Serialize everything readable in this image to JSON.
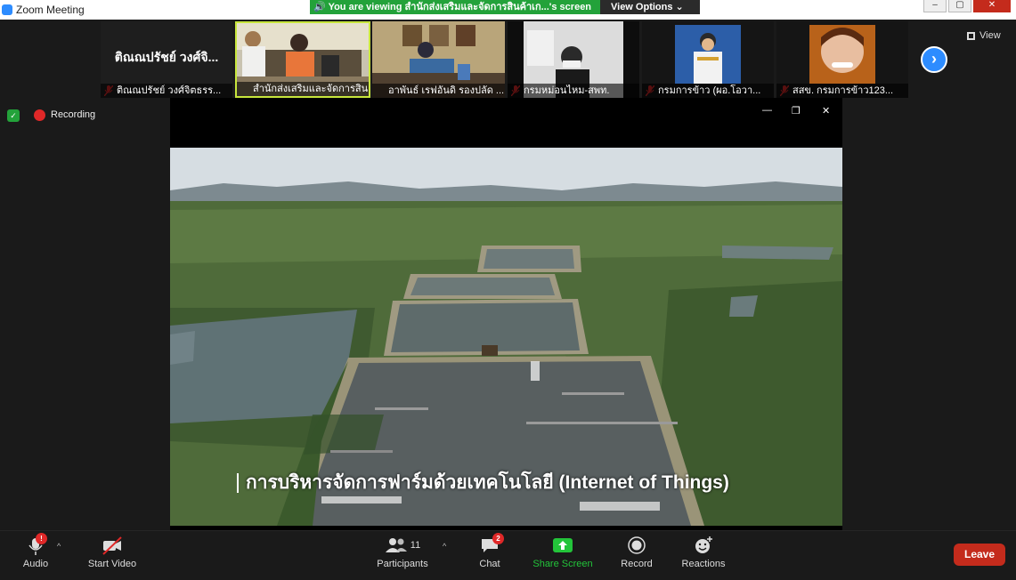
{
  "window": {
    "title": "Zoom Meeting"
  },
  "share_banner": {
    "viewing_text": "You are viewing สำนักส่งเสริมและจัดการสินค้าเก...'s screen",
    "view_options_label": "View Options ⌄"
  },
  "gallery": {
    "view_label": "View",
    "participants": [
      {
        "name": "ติณณปรัชย์ วงศ์จิตธรร...",
        "display": "ติณณปรัชย์ วงศ์จิ...",
        "video": false,
        "muted": true,
        "active": false
      },
      {
        "name": "สำนักส่งเสริมและจัดการสิน...",
        "video": true,
        "muted": false,
        "active": true
      },
      {
        "name": "อาพันธ์ เรฟอันดิ รองปลัด ...",
        "video": true,
        "muted": false,
        "active": false
      },
      {
        "name": "กรมหม่อนไหม-สพท.",
        "video": true,
        "muted": true,
        "active": false
      },
      {
        "name": "กรมการข้าว (ผอ.โอวา...",
        "video": true,
        "muted": true,
        "active": false
      },
      {
        "name": "สสข. กรมการข้าว123...",
        "video": true,
        "muted": true,
        "active": false
      }
    ]
  },
  "status": {
    "recording_label": "Recording"
  },
  "shared_content": {
    "subtitle": "การบริหารจัดการฟาร์มด้วยเทคโนโลยี (Internet of Things)"
  },
  "toolbar": {
    "audio_label": "Audio",
    "audio_badge": "!",
    "video_label": "Start Video",
    "participants_label": "Participants",
    "participants_count": "11",
    "chat_label": "Chat",
    "chat_badge": "2",
    "share_label": "Share Screen",
    "record_label": "Record",
    "reactions_label": "Reactions",
    "leave_label": "Leave"
  },
  "colors": {
    "accent_blue": "#2d8cff",
    "share_green": "#23a23a",
    "leave_red": "#c42b1c",
    "active_speaker": "#c8e63c"
  }
}
